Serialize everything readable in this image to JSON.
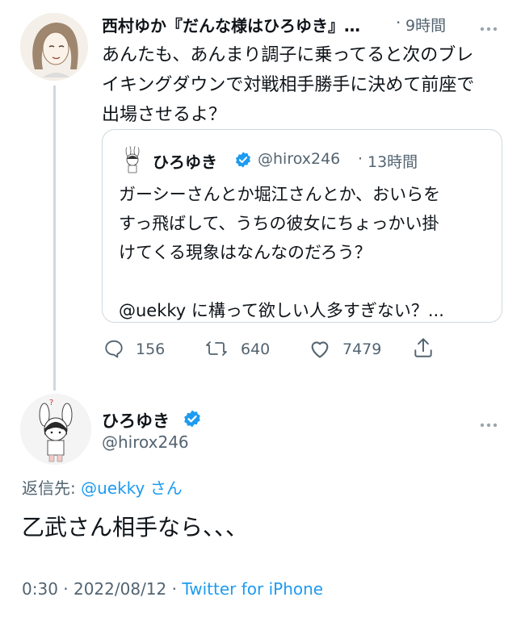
{
  "tweet1": {
    "author_name": "西村ゆか『だんな様はひろゆき』…",
    "time": "9時間",
    "more_icon": "more-dots-icon",
    "text_lines": [
      "あんたも、あんまり調子に乗ってると次のブレ",
      "イキングダウンで対戦相手勝手に決めて前座で",
      "出場させるよ？"
    ],
    "quote": {
      "author_name": "ひろゆき",
      "handle": "@hirox246",
      "sep": "·",
      "time": "13時間",
      "text_lines": [
        "ガーシーさんとか堀江さんとか、おいらを",
        "すっ飛ばして、うちの彼女にちょっかい掛",
        "けてくる現象はなんなのだろう？"
      ],
      "text_last": "@uekky に構って欲しい人多すぎない？..."
    },
    "actions": {
      "reply_count": "156",
      "retweet_count": "640",
      "like_count": "7479"
    }
  },
  "tweet2": {
    "author_name": "ひろゆき",
    "handle": "@hirox246",
    "reply_to_prefix": "返信先:",
    "reply_to_user": "@uekky",
    "reply_to_suffix": "さん",
    "text": "乙武さん相手なら、、、",
    "timestamp": "0:30 · 2022/08/12 ·",
    "source": "Twitter for iPhone"
  },
  "colors": {
    "accent": "#1d9bf0",
    "text": "#0f1419",
    "muted": "#536471",
    "border": "#cfd9de"
  }
}
